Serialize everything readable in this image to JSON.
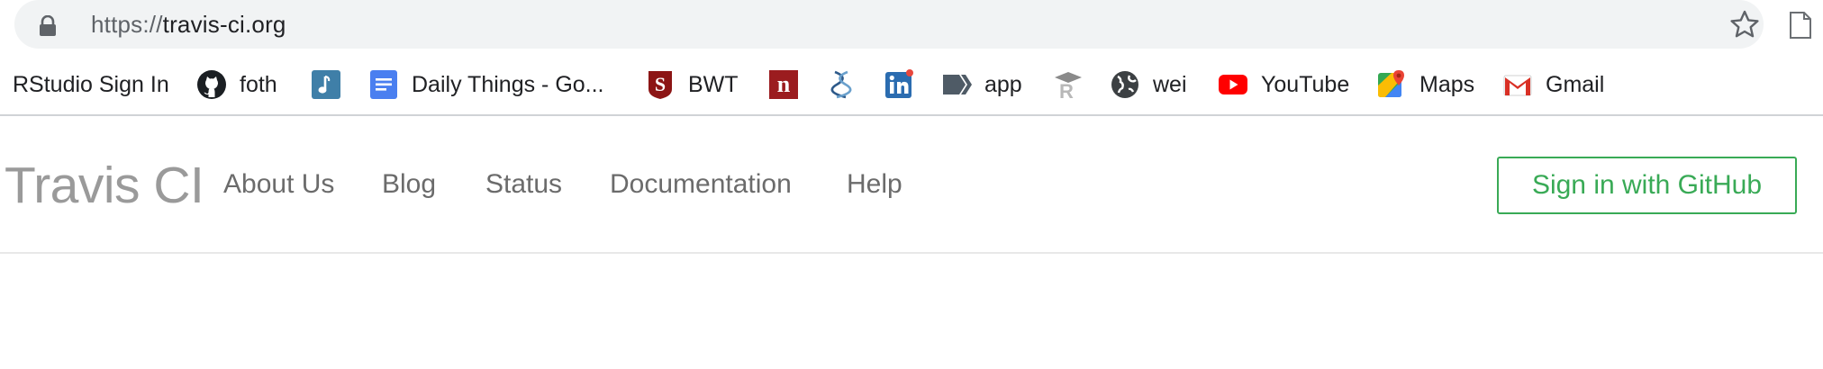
{
  "browser": {
    "url_scheme": "https://",
    "url_host": "travis-ci.org"
  },
  "bookmarks": [
    {
      "label": "RStudio Sign In",
      "icon": "none"
    },
    {
      "label": "foth",
      "icon": "github-icon"
    },
    {
      "label": "",
      "icon": "music-note-icon"
    },
    {
      "label": "Daily Things - Go...",
      "icon": "google-docs-icon"
    },
    {
      "label": "BWT",
      "icon": "stanford-icon"
    },
    {
      "label": "",
      "icon": "n-icon"
    },
    {
      "label": "",
      "icon": "dna-icon"
    },
    {
      "label": "",
      "icon": "linkedin-icon"
    },
    {
      "label": "app",
      "icon": "app-icon"
    },
    {
      "label": "",
      "icon": "r-graduation-icon"
    },
    {
      "label": "wei",
      "icon": "globe-icon"
    },
    {
      "label": "YouTube",
      "icon": "youtube-icon"
    },
    {
      "label": "Maps",
      "icon": "google-maps-icon"
    },
    {
      "label": "Gmail",
      "icon": "gmail-icon"
    }
  ],
  "site": {
    "logo": "Travis CI",
    "nav": [
      "About Us",
      "Blog",
      "Status",
      "Documentation",
      "Help"
    ],
    "signin_label": "Sign in with GitHub"
  },
  "colors": {
    "accent_green": "#39aa56",
    "logo_gray": "#9a9a9a",
    "nav_gray": "#6b6b6b"
  }
}
